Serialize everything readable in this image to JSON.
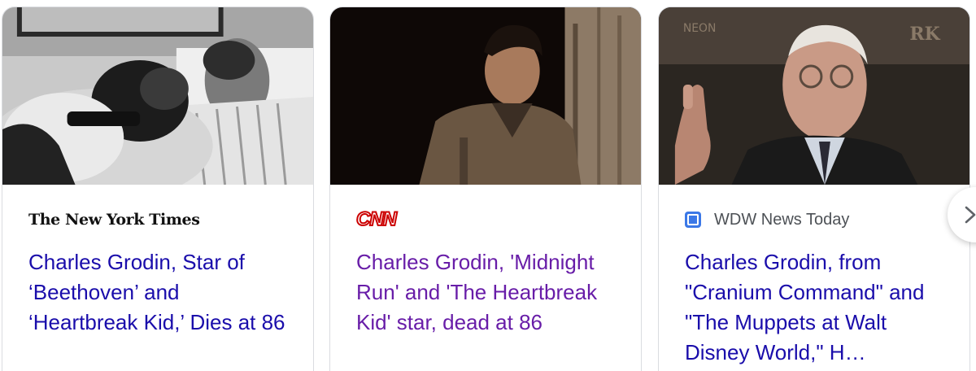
{
  "cards": [
    {
      "source": "The New York Times",
      "source_logo_icon": "nyt-wordmark",
      "headline": "Charles Grodin, Star of ‘Beethoven’ and ‘Heartbreak Kid,’ Dies at 86",
      "headline_color": "#1a0dab"
    },
    {
      "source": "CNN",
      "source_logo_icon": "cnn-wordmark",
      "headline": "Charles Grodin, 'Midnight Run' and 'The Heartbreak Kid' star, dead at 86",
      "headline_color": "#681da8"
    },
    {
      "source": "WDW News Today",
      "source_logo_icon": "wdw-news-today-favicon",
      "headline": "Charles Grodin, from \"Cranium Command\" and \"The Muppets at Walt Disney World,\" H…",
      "headline_color": "#1a0dab"
    }
  ],
  "carousel": {
    "next_icon": "chevron-right-icon"
  }
}
